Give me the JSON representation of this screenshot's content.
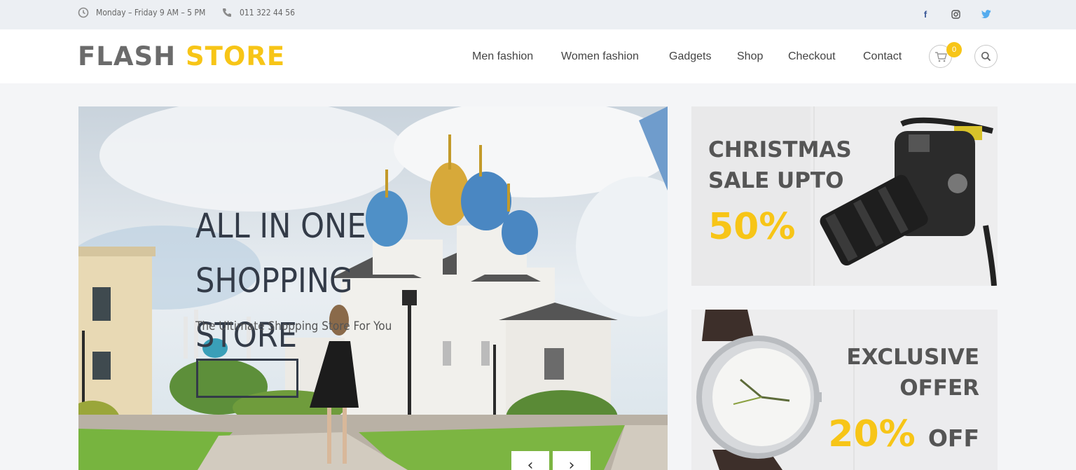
{
  "topbar": {
    "hours_icon": "clock-icon",
    "hours": "Monday – Friday 9 AM – 5 PM",
    "phone_icon": "phone-icon",
    "phone": "011 322 44 56",
    "social": [
      {
        "name": "facebook-icon",
        "glyph": "f",
        "color": "#3b5998"
      },
      {
        "name": "instagram-icon",
        "glyph": "",
        "color": "#555555"
      },
      {
        "name": "twitter-icon",
        "glyph": "",
        "color": "#55acee"
      }
    ]
  },
  "header": {
    "logo_part1": "FLASH",
    "logo_part2": "STORE",
    "nav": [
      "Men fashion",
      "Women fashion",
      "Gadgets",
      "Shop",
      "Checkout",
      "Contact"
    ],
    "cart_icon": "cart-icon",
    "cart_count": "0",
    "search_icon": "search-icon"
  },
  "hero": {
    "title_line1": "ALL IN ONE SHOPPING",
    "title_line2": "STORE",
    "subtitle": "The Ultimate Shopping Store For You",
    "button_label": "",
    "prev_label": "‹",
    "next_label": "›"
  },
  "promos": [
    {
      "line1": "CHRISTMAS",
      "line2": "SALE UPTO",
      "percent": "50%",
      "suffix": ""
    },
    {
      "line1": "EXCLUSIVE",
      "line2": "OFFER",
      "percent": "20%",
      "suffix": "OFF"
    }
  ],
  "colors": {
    "accent": "#f7c517",
    "dark": "#333b48",
    "topbar_bg": "#eceff3"
  }
}
